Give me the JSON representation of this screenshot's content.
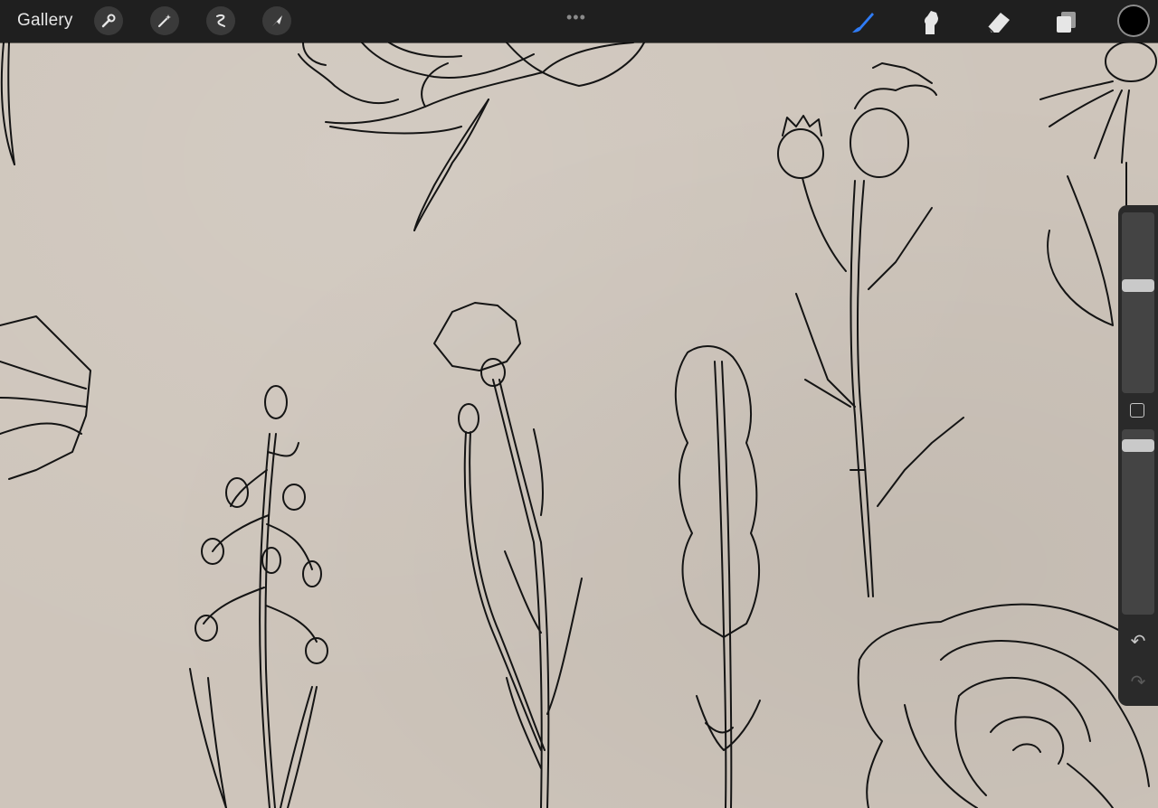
{
  "topbar": {
    "gallery_label": "Gallery",
    "left_tools": [
      "wrench-icon",
      "magic-wand-icon",
      "selection-icon",
      "transform-arrow-icon"
    ],
    "more_label": "•••",
    "right_tools": [
      "brush-icon",
      "smudge-icon",
      "eraser-icon",
      "layers-icon"
    ],
    "current_color": "#000000",
    "active_tool": "brush",
    "accent": "#2f7cf6"
  },
  "sidebar": {
    "brush_size": 0.2,
    "brush_opacity": 0.06,
    "undo_icon": "↶",
    "redo_icon": "↷"
  },
  "canvas": {
    "paper_color": "#cec5bb",
    "ink_color": "#141414",
    "subjects": [
      "rose",
      "thistle",
      "cornflower",
      "lavender",
      "quaking-grass",
      "daisy"
    ]
  }
}
